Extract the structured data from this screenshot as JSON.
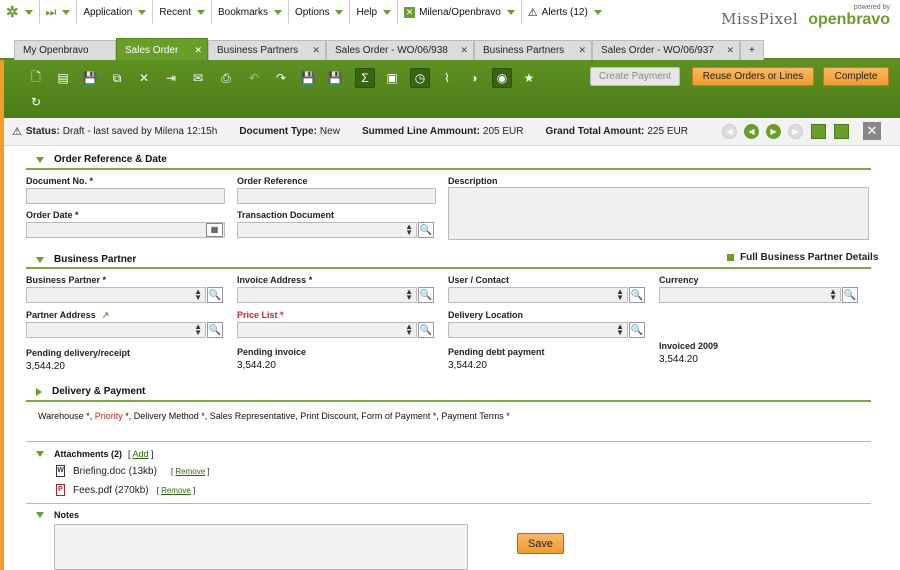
{
  "topbar": {
    "menus": [
      "Application",
      "Recent",
      "Bookmarks",
      "Options",
      "Help"
    ],
    "user": "Milena/Openbravo",
    "alerts": "Alerts (12)",
    "brand1": "MissPixel",
    "powered_by": "powered by",
    "brand2": "openbravo"
  },
  "tabs": [
    {
      "label": "My Openbravo"
    },
    {
      "label": "Sales Order"
    },
    {
      "label": "Business Partners"
    },
    {
      "label": "Sales Order - WO/06/938"
    },
    {
      "label": "Business Partners"
    },
    {
      "label": "Sales Order - WO/06/937"
    },
    {
      "label": "+"
    }
  ],
  "actions": {
    "create_payment": "Create Payment",
    "reuse": "Reuse Orders or Lines",
    "complete": "Complete"
  },
  "status": {
    "status_label": "Status:",
    "status_value": "Draft - last saved by Milena 12:15h",
    "doctype_label": "Document Type:",
    "doctype_value": "New",
    "summed_label": "Summed Line Ammount:",
    "summed_value": "205 EUR",
    "grand_label": "Grand Total Amount:",
    "grand_value": "225 EUR"
  },
  "order_ref": {
    "title": "Order Reference & Date",
    "document_no": "Document No. *",
    "order_reference": "Order Reference",
    "description": "Description",
    "order_date": "Order Date *",
    "transaction_document": "Transaction Document"
  },
  "bp": {
    "title": "Business Partner",
    "full_details": "Full Business Partner Details",
    "business_partner": "Business Partner *",
    "invoice_address": "Invoice Address *",
    "user_contact": "User / Contact",
    "currency": "Currency",
    "partner_address": "Partner Address",
    "price_list": "Price List *",
    "delivery_location": "Delivery Location",
    "pending_delivery_label": "Pending delivery/receipt",
    "pending_delivery_value": "3,544.20",
    "pending_invoice_label": "Pending invoice",
    "pending_invoice_value": "3,544.20",
    "pending_debt_label": "Pending debt payment",
    "pending_debt_value": "3,544.20",
    "invoiced_label": "Invoiced 2009",
    "invoiced_value": "3,544.20"
  },
  "delivery": {
    "title": "Delivery & Payment",
    "fields_a": "Warehouse *, ",
    "fields_priority": "Priority",
    "fields_b": " *, Delivery Method *, Sales Representative, Print Discount, Form of Payment *, Payment Terms *"
  },
  "attachments": {
    "title": "Attachments (2)",
    "add": "Add",
    "remove": "Remove",
    "files": [
      {
        "name": "Briefing.doc",
        "size": "(13kb)"
      },
      {
        "name": "Fees.pdf",
        "size": "(270kb)"
      }
    ]
  },
  "notes": {
    "title": "Notes",
    "save": "Save"
  },
  "colors": {
    "accent_green": "#6a9e2a",
    "toolbar_green": "#5a8a1e",
    "orange": "#f39c2c"
  }
}
